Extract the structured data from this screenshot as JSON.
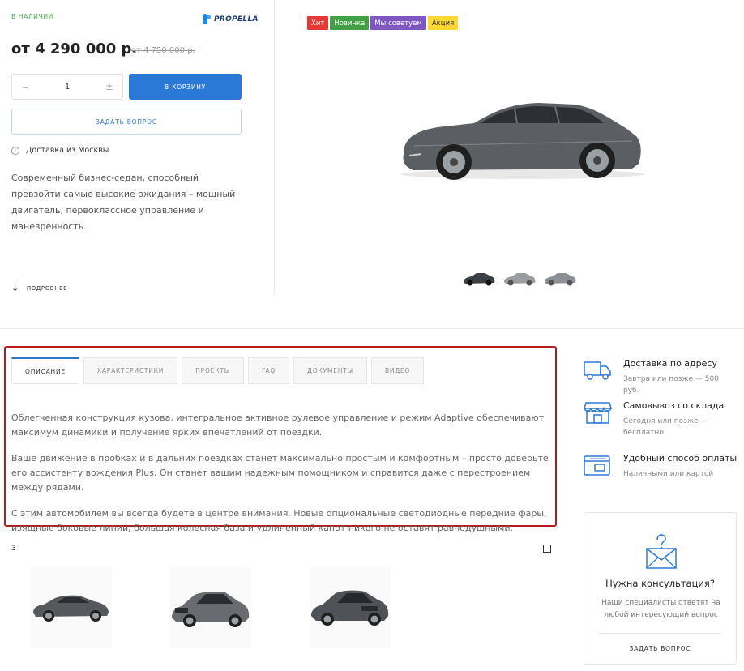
{
  "product": {
    "stock": "В НАЛИЧИИ",
    "brand": "PROPELLA",
    "price": "от 4 290 000 р.",
    "old_price": "от 4 750 000 р.",
    "quantity": "1",
    "minus": "–",
    "plus": "±",
    "cart_label": "В КОРЗИНУ",
    "ask_label": "ЗАДАТЬ ВОПРОС",
    "delivery": "Доставка из Москвы",
    "description": "Современный бизнес-седан, способный превзойти самые высокие ожидания – мощный двигатель, первоклассное управление и маневренность.",
    "more_label": "ПОДРОБНЕЕ"
  },
  "badges": [
    {
      "label": "Хит",
      "color": "#e53935"
    },
    {
      "label": "Новинка",
      "color": "#43a047"
    },
    {
      "label": "Мы советуем",
      "color": "#7e57c2"
    },
    {
      "label": "Акция",
      "color": "#fdd835"
    }
  ],
  "tabs": [
    {
      "label": "ОПИСАНИЕ"
    },
    {
      "label": "ХАРАКТЕРИСТИКИ"
    },
    {
      "label": "ПРОЕКТЫ"
    },
    {
      "label": "FAQ"
    },
    {
      "label": "ДОКУМЕНТЫ"
    },
    {
      "label": "ВИДЕО"
    }
  ],
  "tab_content": [
    "Облегченная конструкция кузова, интегральное активное рулевое управление и режим Adaptive обеспечивают максимум динамики и получение ярких впечатлений от поездки.",
    "Ваше движение в пробках и в дальних поездках станет максимально простым и комфортным – просто доверьте его ассистенту вождения Plus. Он станет вашим надежным помощником и справится даже с перестроением между рядами.",
    "С этим автомобилем вы всегда будете в центре внимания. Новые опциональные светодиодные передние фары, изящные боковые линии, большая колесная база и удлиненный капот никого не оставят равнодушными."
  ],
  "related": {
    "count": "3"
  },
  "features": [
    {
      "title": "Доставка по адресу",
      "sub": "Завтра или позже — 500 руб.",
      "icon": "truck-icon"
    },
    {
      "title": "Самовывоз со склада",
      "sub": "Сегодня или позже — бесплатно",
      "icon": "store-icon"
    },
    {
      "title": "Удобный способ оплаты",
      "sub": "Наличными или картой",
      "icon": "wallet-icon"
    }
  ],
  "consult": {
    "title": "Нужна консультация?",
    "sub": "Наши специалисты ответят на любой интересующий вопрос",
    "button": "ЗАДАТЬ ВОПРОС",
    "icon": "mail-question-icon"
  },
  "colors": {
    "accent": "#2b79d6",
    "in_stock": "#4caf50",
    "highlight_frame": "#b71c1c"
  }
}
